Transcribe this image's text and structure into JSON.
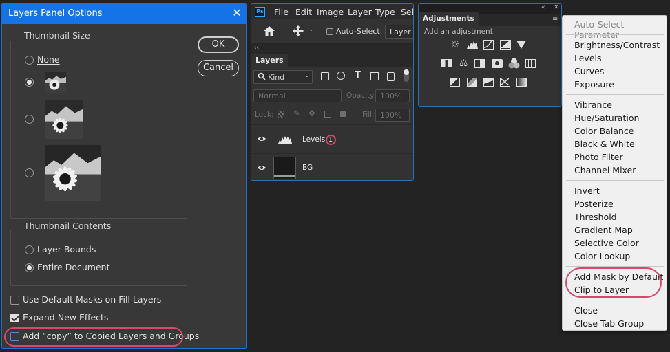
{
  "dialog": {
    "title": "Layers Panel Options",
    "close_glyph": "✕",
    "thumbnail_size": {
      "legend": "Thumbnail Size",
      "options": [
        "None",
        "small",
        "medium",
        "large"
      ],
      "none_label": "None",
      "selected": "small"
    },
    "thumbnail_contents": {
      "legend": "Thumbnail Contents",
      "layer_bounds": "Layer Bounds",
      "entire_document": "Entire Document",
      "selected": "Entire Document"
    },
    "checkboxes": {
      "use_default_masks": {
        "label": "Use Default Masks on Fill Layers",
        "checked": false
      },
      "expand_new_effects": {
        "label": "Expand New Effects",
        "checked": true
      },
      "add_copy": {
        "label": "Add “copy” to Copied Layers and Groups",
        "checked": false
      }
    },
    "ok_label": "OK",
    "cancel_label": "Cancel"
  },
  "app": {
    "logo": "Ps",
    "menu": [
      "File",
      "Edit",
      "Image",
      "Layer",
      "Type",
      "Sele"
    ],
    "toolbar": {
      "auto_select_label": "Auto-Select:",
      "auto_select_target": "Layer"
    }
  },
  "layers_panel": {
    "collapse": "‹‹",
    "tab": "Layers",
    "filter_kind": "Kind",
    "blend_mode": "Normal",
    "opacity_label": "Opacity:",
    "opacity_value": "100%",
    "lock_label": "Lock:",
    "fill_label": "Fill:",
    "fill_value": "100%",
    "layers": [
      {
        "name": "Levels 1",
        "name_text": "Levels",
        "badge": "1",
        "type": "adjustment"
      },
      {
        "name": "BG",
        "name_text": "BG",
        "type": "pixel"
      }
    ]
  },
  "adjustments_panel": {
    "tab": "Adjustments",
    "subtitle": "Add an adjustment",
    "collapse": "«",
    "close": "✕"
  },
  "flyout_menu": {
    "header": "Auto-Select Parameter",
    "group1": [
      "Brightness/Contrast",
      "Levels",
      "Curves",
      "Exposure"
    ],
    "group2": [
      "Vibrance",
      "Hue/Saturation",
      "Color Balance",
      "Black & White",
      "Photo Filter",
      "Channel Mixer"
    ],
    "group3": [
      "Invert",
      "Posterize",
      "Threshold",
      "Gradient Map",
      "Selective Color",
      "Color Lookup"
    ],
    "group4": [
      "Add Mask by Default",
      "Clip to Layer"
    ],
    "group5": [
      "Close",
      "Close Tab Group"
    ]
  },
  "colors": {
    "highlight": "#d9486a",
    "accent": "#1473e6"
  }
}
